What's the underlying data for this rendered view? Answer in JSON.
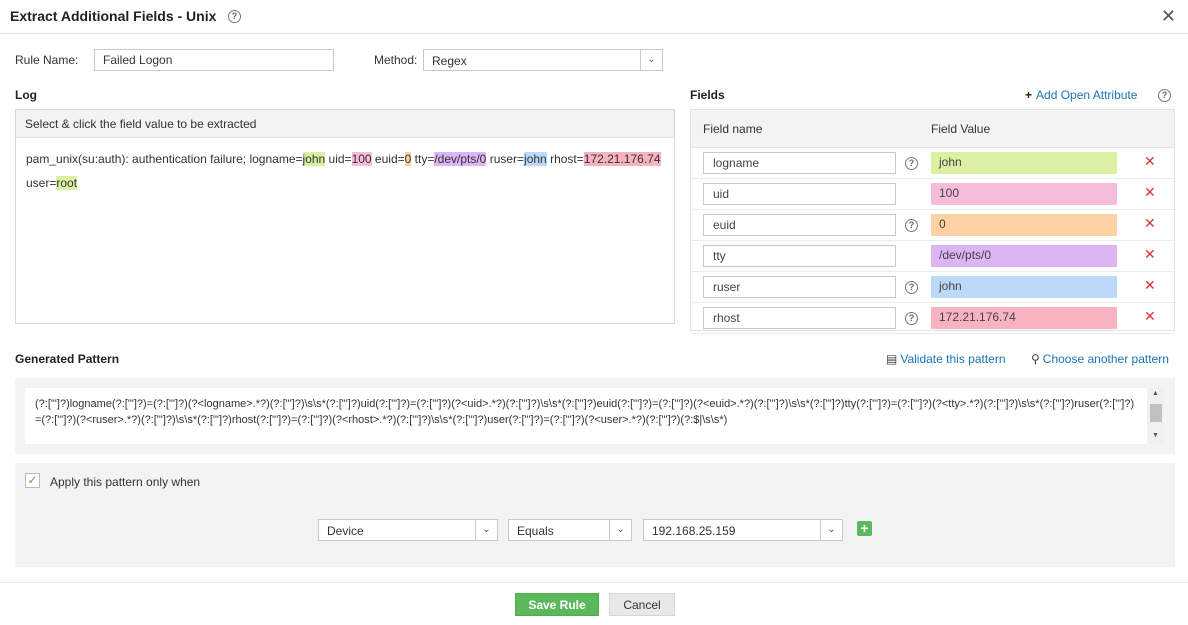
{
  "dialog": {
    "title": "Extract Additional Fields - Unix",
    "help": "?",
    "close": "✕"
  },
  "rule": {
    "name_label": "Rule Name:",
    "name_value": "Failed Logon",
    "method_label": "Method:",
    "method_value": "Regex"
  },
  "log": {
    "title": "Log",
    "instruction": "Select & click the field value to be extracted",
    "segments": [
      {
        "text": "pam_unix(su:auth): authentication failure; logname=",
        "hl": ""
      },
      {
        "text": "john",
        "hl": "green"
      },
      {
        "text": " uid=",
        "hl": ""
      },
      {
        "text": "100",
        "hl": "pink"
      },
      {
        "text": " euid=",
        "hl": ""
      },
      {
        "text": "0",
        "hl": "orange"
      },
      {
        "text": " tty=",
        "hl": ""
      },
      {
        "text": "/dev/pts/0",
        "hl": "purple"
      },
      {
        "text": " ruser=",
        "hl": ""
      },
      {
        "text": "john",
        "hl": "blue"
      },
      {
        "text": " rhost=",
        "hl": ""
      },
      {
        "text": "172.21.176.74",
        "hl": "red"
      },
      {
        "text": " user=",
        "hl": ""
      },
      {
        "text": "root",
        "hl": "green"
      }
    ]
  },
  "fields": {
    "title": "Fields",
    "add_link": "Add Open Attribute",
    "col_name": "Field name",
    "col_value": "Field Value",
    "rows": [
      {
        "name": "logname",
        "value": "john",
        "color": "#dbf0a3",
        "help": true
      },
      {
        "name": "uid",
        "value": "100",
        "color": "#f5bdd9",
        "help": false
      },
      {
        "name": "euid",
        "value": "0",
        "color": "#fdd1a4",
        "help": true
      },
      {
        "name": "tty",
        "value": "/dev/pts/0",
        "color": "#dcb5f5",
        "help": false
      },
      {
        "name": "ruser",
        "value": "john",
        "color": "#bcd9fa",
        "help": true
      },
      {
        "name": "rhost",
        "value": "172.21.176.74",
        "color": "#f8b3c0",
        "help": true
      }
    ]
  },
  "pattern": {
    "title": "Generated Pattern",
    "validate_link": "Validate this pattern",
    "choose_link": "Choose another pattern",
    "text": "(?:[\"']?)logname(?:[\"']?)=(?:[\"']?)(?<logname>.*?)(?:[\"']?)\\s\\s*(?:[\"']?)uid(?:[\"']?)=(?:[\"']?)(?<uid>.*?)(?:[\"']?)\\s\\s*(?:[\"']?)euid(?:[\"']?)=(?:[\"']?)(?<euid>.*?)(?:[\"']?)\\s\\s*(?:[\"']?)tty(?:[\"']?)=(?:[\"']?)(?<tty>.*?)(?:[\"']?)\\s\\s*(?:[\"']?)ruser(?:[\"']?)=(?:[\"']?)(?<ruser>.*?)(?:[\"']?)\\s\\s*(?:[\"']?)rhost(?:[\"']?)=(?:[\"']?)(?<rhost>.*?)(?:[\"']?)\\s\\s*(?:[\"']?)user(?:[\"']?)=(?:[\"']?)(?<user>.*?)(?:[\"']?)(?:$|\\s\\s*)"
  },
  "condition": {
    "apply_label": "Apply this pattern only when",
    "checked": true,
    "field": "Device",
    "operator": "Equals",
    "value": "192.168.25.159"
  },
  "buttons": {
    "save": "Save Rule",
    "cancel": "Cancel"
  }
}
